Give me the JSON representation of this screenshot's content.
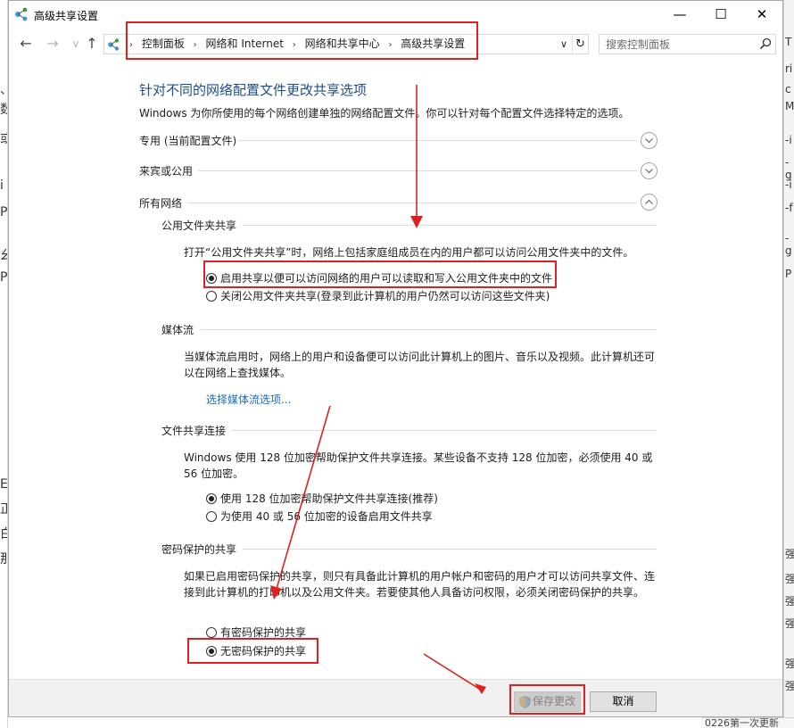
{
  "window": {
    "title": "高级共享设置",
    "minimize_glyph": "—",
    "maximize_glyph": "☐",
    "close_glyph": "✕"
  },
  "nav": {
    "back_glyph": "←",
    "forward_glyph": "→",
    "up_glyph": "↑",
    "breadcrumbs": [
      "控制面板",
      "网络和 Internet",
      "网络和共享中心",
      "高级共享设置"
    ],
    "breadcrumb_separator": "›",
    "dropdown_glyph": "∨",
    "refresh_glyph": "↻",
    "search_placeholder": "搜索控制面板"
  },
  "main": {
    "title": "针对不同的网络配置文件更改共享选项",
    "description": "Windows 为你所使用的每个网络创建单独的网络配置文件。你可以针对每个配置文件选择特定的选项。",
    "profiles": [
      {
        "label": "专用 (当前配置文件)",
        "expanded": false
      },
      {
        "label": "来宾或公用",
        "expanded": false
      },
      {
        "label": "所有网络",
        "expanded": true
      }
    ],
    "sections": {
      "public_folder": {
        "title": "公用文件夹共享",
        "description": "打开“公用文件夹共享”时，网络上包括家庭组成员在内的用户都可以访问公用文件夹中的文件。",
        "options": [
          {
            "label": "启用共享以便可以访问网络的用户可以读取和写入公用文件夹中的文件",
            "checked": true
          },
          {
            "label": "关闭公用文件夹共享(登录到此计算机的用户仍然可以访问这些文件夹)",
            "checked": false
          }
        ]
      },
      "media": {
        "title": "媒体流",
        "description": "当媒体流启用时，网络上的用户和设备便可以访问此计算机上的图片、音乐以及视频。此计算机还可以在网络上查找媒体。",
        "link": "选择媒体流选项..."
      },
      "file_sharing": {
        "title": "文件共享连接",
        "description": "Windows 使用 128 位加密帮助保护文件共享连接。某些设备不支持 128 位加密，必须使用 40 或 56 位加密。",
        "options": [
          {
            "label": "使用 128 位加密帮助保护文件共享连接(推荐)",
            "checked": true
          },
          {
            "label": "为使用 40 或 56 位加密的设备启用文件共享",
            "checked": false
          }
        ]
      },
      "password": {
        "title": "密码保护的共享",
        "description": "如果已启用密码保护的共享，则只有具备此计算机的用户帐户和密码的用户才可以访问共享文件、连接到此计算机的打印机以及公用文件夹。若要使其他人具备访问权限，必须关闭密码保护的共享。",
        "options": [
          {
            "label": "有密码保护的共享",
            "checked": false
          },
          {
            "label": "无密码保护的共享",
            "checked": true
          }
        ]
      }
    }
  },
  "buttons": {
    "save": "保存更改",
    "cancel": "取消"
  },
  "background": {
    "bottom_right_text": "0226第一次更新"
  },
  "colors": {
    "title_blue": "#1e4e8c",
    "link_blue": "#1a6bc7",
    "annotation_red": "#e02020"
  }
}
